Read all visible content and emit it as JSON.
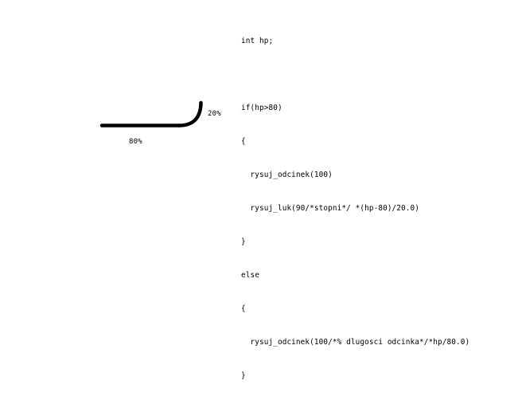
{
  "diagram": {
    "line_share_label": "80%",
    "arc_share_label": "20%",
    "stroke_color": "#000000",
    "background_color": "#ffffff"
  },
  "code": {
    "lines": [
      "int hp;",
      "",
      "if(hp>80)",
      "{",
      "  rysuj_odcinek(100)",
      "  rysuj_luk(90/*stopni*/ *(hp-80)/20.0)",
      "}",
      "else",
      "{",
      "  rysuj_odcinek(100/*% dlugosci odcinka*/*hp/80.0)",
      "}"
    ]
  }
}
